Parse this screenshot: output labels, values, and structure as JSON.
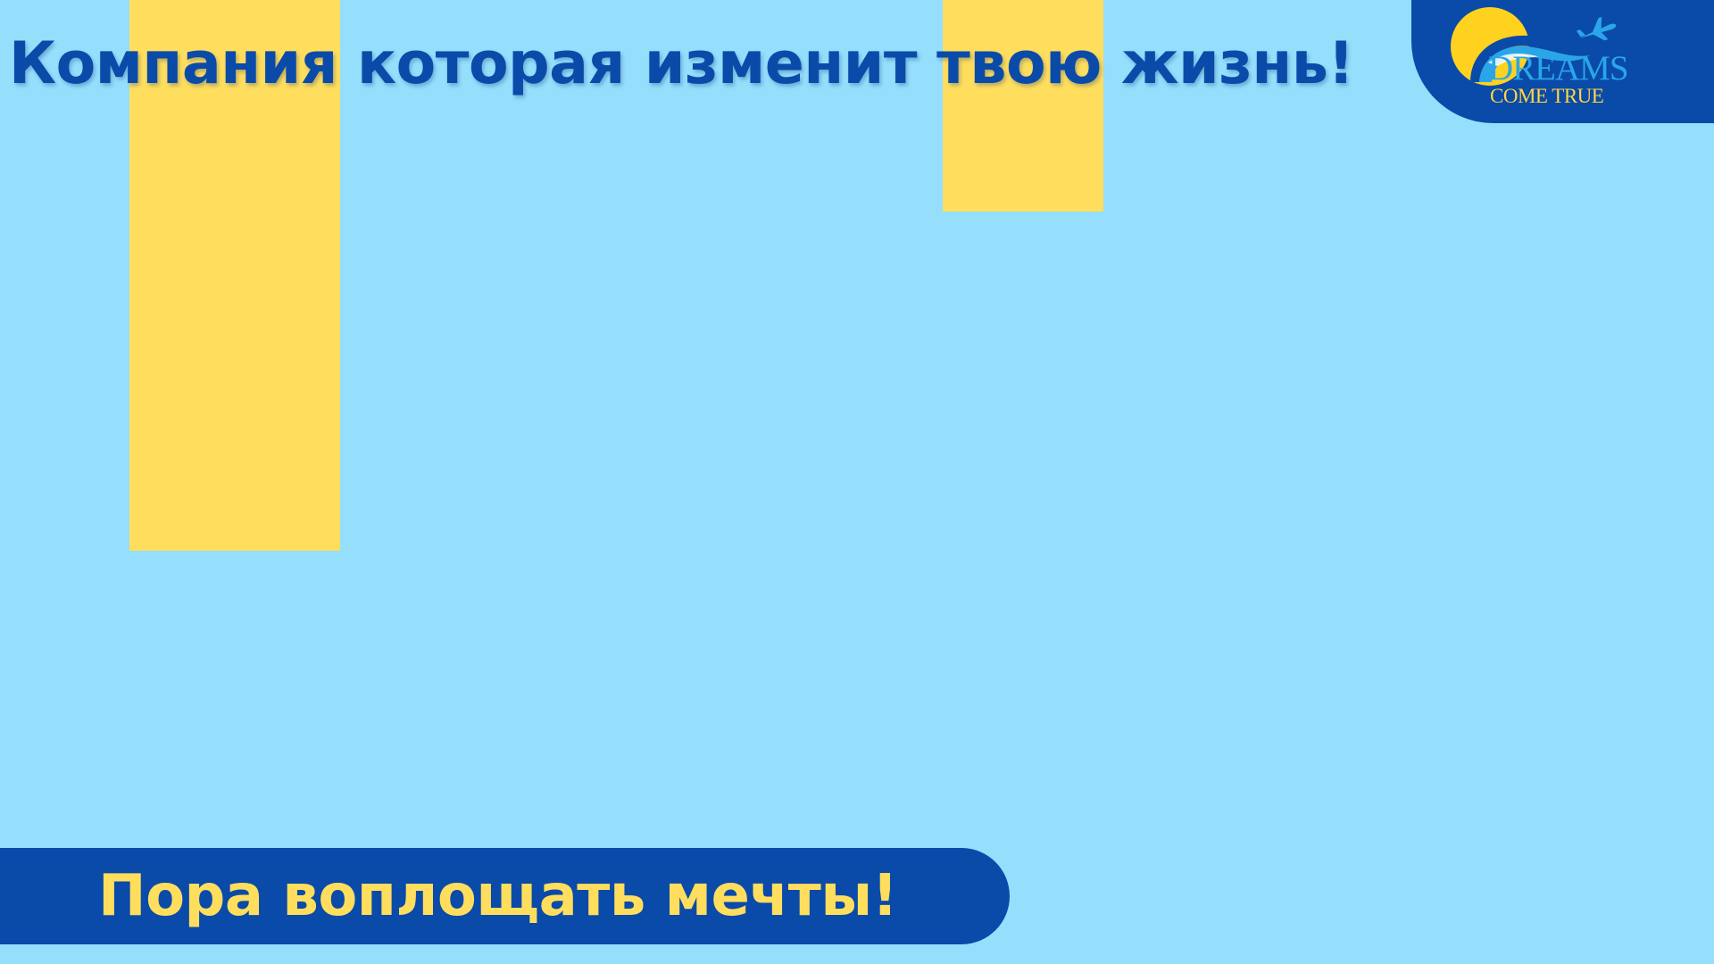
{
  "headline": "Компания которая изменит твою жизнь!",
  "logo": {
    "line1": "DREAMS",
    "line2": "COME TRUE",
    "icons": [
      "sun-icon",
      "wave-icon",
      "airplane-icon"
    ]
  },
  "cta": {
    "text": "Пора воплощать мечты!"
  },
  "colors": {
    "background": "#95dffd",
    "accent_yellow": "#ffde5e",
    "brand_blue": "#0a4aa9",
    "logo_light_blue": "#2aa6e8"
  }
}
